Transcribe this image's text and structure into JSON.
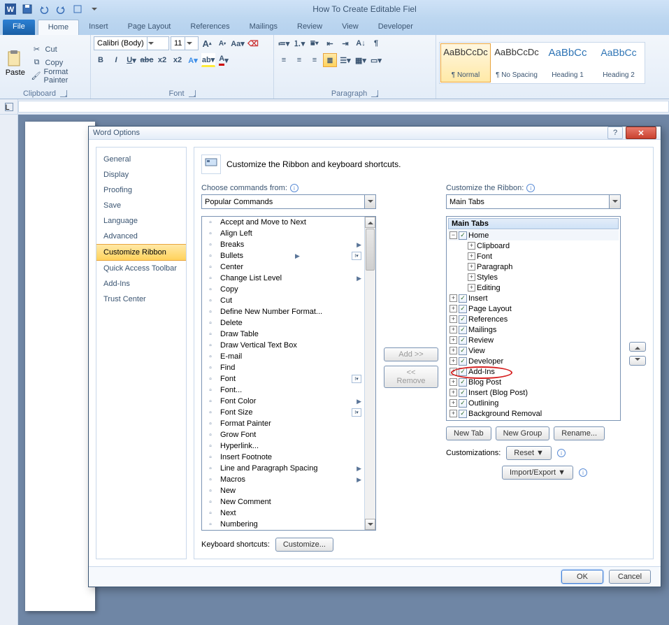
{
  "app": {
    "title": "How To Create Editable Fiel"
  },
  "tabs": {
    "file": "File",
    "home": "Home",
    "insert": "Insert",
    "page_layout": "Page Layout",
    "references": "References",
    "mailings": "Mailings",
    "review": "Review",
    "view": "View",
    "developer": "Developer"
  },
  "ribbon": {
    "clipboard": {
      "label": "Clipboard",
      "paste": "Paste",
      "cut": "Cut",
      "copy": "Copy",
      "format_painter": "Format Painter"
    },
    "font": {
      "label": "Font",
      "name": "Calibri (Body)",
      "size": "11"
    },
    "paragraph": {
      "label": "Paragraph"
    },
    "styles": {
      "items": [
        {
          "preview": "AaBbCcDc",
          "name": "¶ Normal"
        },
        {
          "preview": "AaBbCcDc",
          "name": "¶ No Spacing"
        },
        {
          "preview": "AaBbCc",
          "name": "Heading 1"
        },
        {
          "preview": "AaBbCc",
          "name": "Heading 2"
        }
      ]
    }
  },
  "dialog": {
    "title": "Word Options",
    "sidebar": [
      "General",
      "Display",
      "Proofing",
      "Save",
      "Language",
      "Advanced",
      "Customize Ribbon",
      "Quick Access Toolbar",
      "Add-Ins",
      "Trust Center"
    ],
    "heading": "Customize the Ribbon and keyboard shortcuts.",
    "choose_label": "Choose commands from:",
    "choose_value": "Popular Commands",
    "customize_label": "Customize the Ribbon:",
    "customize_value": "Main Tabs",
    "commands": [
      {
        "t": "Accept and Move to Next"
      },
      {
        "t": "Align Left"
      },
      {
        "t": "Breaks",
        "sub": true
      },
      {
        "t": "Bullets",
        "sub": true,
        "mini": true
      },
      {
        "t": "Center"
      },
      {
        "t": "Change List Level",
        "sub": true
      },
      {
        "t": "Copy"
      },
      {
        "t": "Cut"
      },
      {
        "t": "Define New Number Format..."
      },
      {
        "t": "Delete"
      },
      {
        "t": "Draw Table"
      },
      {
        "t": "Draw Vertical Text Box"
      },
      {
        "t": "E-mail"
      },
      {
        "t": "Find"
      },
      {
        "t": "Font",
        "mini": true
      },
      {
        "t": "Font..."
      },
      {
        "t": "Font Color",
        "sub": true
      },
      {
        "t": "Font Size",
        "mini": true
      },
      {
        "t": "Format Painter"
      },
      {
        "t": "Grow Font"
      },
      {
        "t": "Hyperlink..."
      },
      {
        "t": "Insert Footnote"
      },
      {
        "t": "Line and Paragraph Spacing",
        "sub": true
      },
      {
        "t": "Macros",
        "sub": true
      },
      {
        "t": "New"
      },
      {
        "t": "New Comment"
      },
      {
        "t": "Next"
      },
      {
        "t": "Numbering"
      }
    ],
    "tree_header": "Main Tabs",
    "tree": {
      "home": "Home",
      "home_children": [
        "Clipboard",
        "Font",
        "Paragraph",
        "Styles",
        "Editing"
      ],
      "rest": [
        "Insert",
        "Page Layout",
        "References",
        "Mailings",
        "Review",
        "View",
        "Developer",
        "Add-Ins",
        "Blog Post",
        "Insert (Blog Post)",
        "Outlining",
        "Background Removal"
      ]
    },
    "add": "Add >>",
    "remove": "<< Remove",
    "new_tab": "New Tab",
    "new_group": "New Group",
    "rename": "Rename...",
    "customizations": "Customizations:",
    "reset": "Reset ▼",
    "import_export": "Import/Export ▼",
    "kb_shortcuts": "Keyboard shortcuts:",
    "customize_btn": "Customize...",
    "ok": "OK",
    "cancel": "Cancel"
  }
}
